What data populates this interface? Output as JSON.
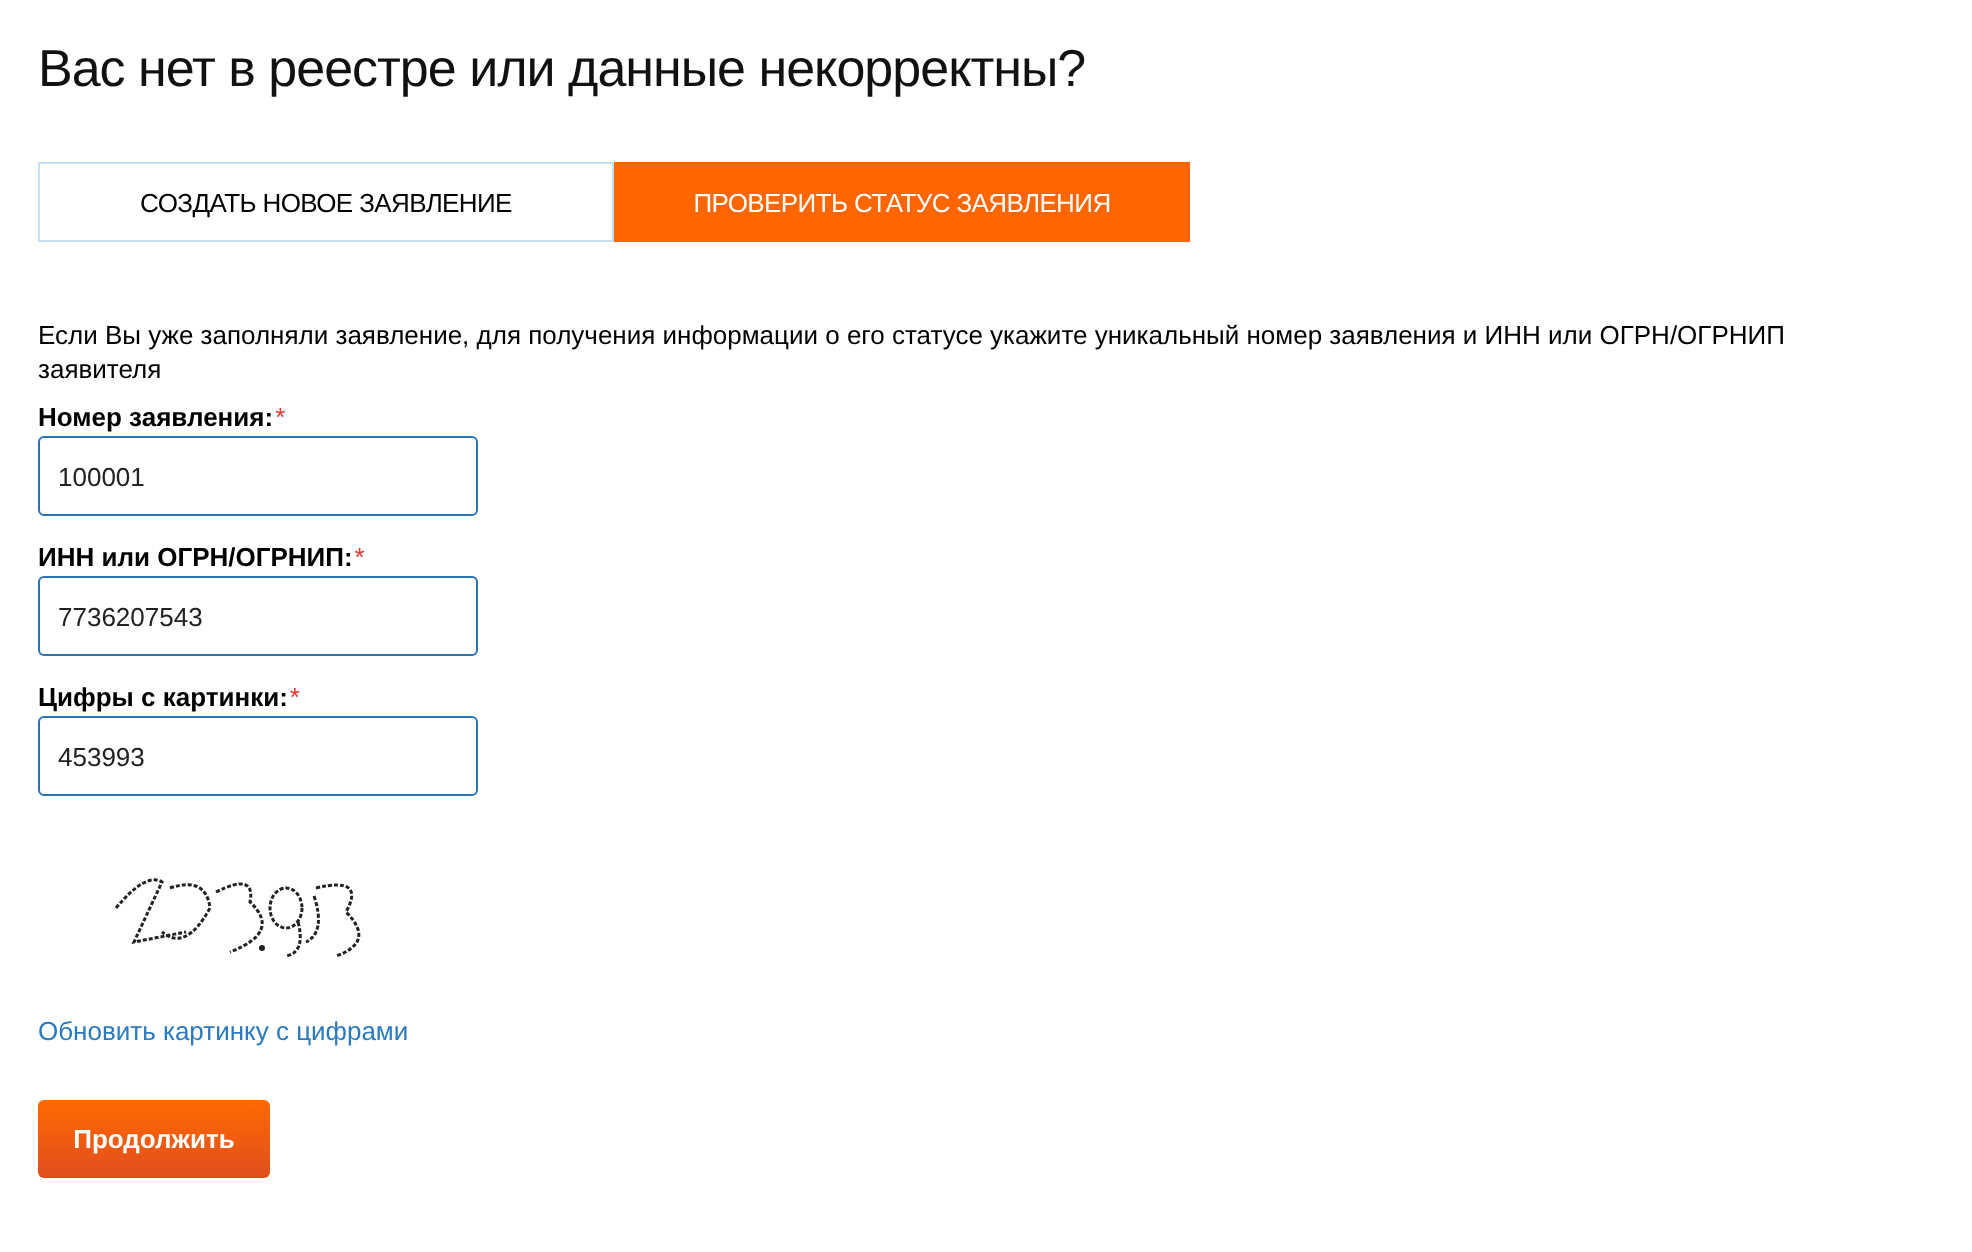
{
  "title": "Вас нет в реестре или данные некорректны?",
  "tabs": [
    {
      "label": "СОЗДАТЬ НОВОЕ ЗАЯВЛЕНИЕ",
      "selected": false
    },
    {
      "label": "ПРОВЕРИТЬ СТАТУС ЗАЯВЛЕНИЯ",
      "selected": true
    }
  ],
  "intro": "Если Вы уже заполняли заявление, для получения информации о его статусе укажите уникальный номер заявления и ИНН или ОГРН/ОГРНИП заявителя",
  "fields": [
    {
      "label": "Номер заявления:",
      "required_mark": "*",
      "value": "100001"
    },
    {
      "label": "ИНН или ОГРН/ОГРНИП:",
      "required_mark": "*",
      "value": "7736207543"
    },
    {
      "label": "Цифры с картинки:",
      "required_mark": "*",
      "value": "453993"
    }
  ],
  "refresh_link": "Обновить картинку с цифрами",
  "submit_button": "Продолжить"
}
